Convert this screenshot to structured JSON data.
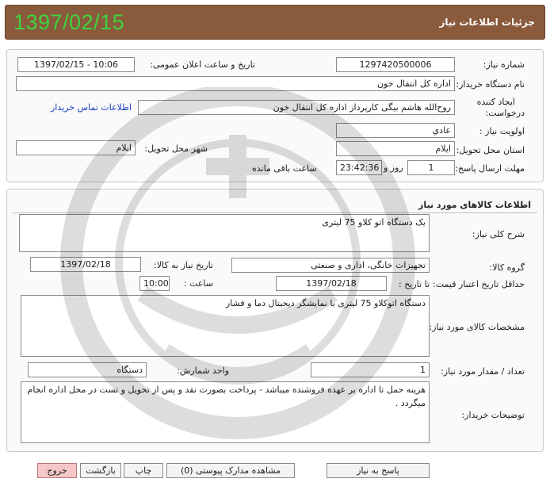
{
  "header": {
    "title": "جزئیات اطلاعات نیاز",
    "date": "1397/02/15"
  },
  "info": {
    "need_number_label": "شماره نیاز:",
    "need_number": "1297420500006",
    "announce_label": "تاریخ و ساعت اعلان عمومی:",
    "announce_value": "1397/02/15 - 10:06",
    "buyer_org_label": "نام دستگاه خریدار:",
    "buyer_org": "اداره کل انتقال خون",
    "creator_label_1": "ایجاد کننده",
    "creator_label_2": "درخواست:",
    "creator": "روح‌الله هاشم بیگی کارپرداز اداره کل انتقال خون",
    "contact_link": "اطلاعات تماس خریدار",
    "priority_label": "اولویت نیاز :",
    "priority": "عادي",
    "province_label": "استان محل تحویل:",
    "province": "ایلام",
    "city_label": "شهر محل تحویل:",
    "city": "ایلام",
    "deadline_label": "مهلت ارسال پاسخ:",
    "deadline_days": "1",
    "days_unit": "روز و",
    "deadline_time": "23:42:36",
    "remaining_label": "ساعت باقی مانده"
  },
  "goods": {
    "section_title": "اطلاعات کالاهای مورد نیاز",
    "summary_label": "شرح کلی نیاز:",
    "summary": "یک دستگاه اتو کلاو 75 لیتری",
    "group_label": "گروه کالا:",
    "group": "تجهیزات خانگی، اداری و صنعتی",
    "need_date_label": "تاریخ نیاز به کالا:",
    "need_date": "1397/02/18",
    "min_validity_label": "حداقل تاریخ اعتبار قیمت:",
    "until_date_label": "تا تاریخ :",
    "until_date": "1397/02/18",
    "time_label": "ساعت :",
    "time": "10:00",
    "specs_label": "مشخصات کالای مورد نیاز:",
    "specs": "دستگاه اتوکلاو 75 لیتری با نمایشگر دیجیتال دما و فشار",
    "qty_label": "تعداد / مقدار مورد نیاز:",
    "qty": "1",
    "unit_label": "واحد شمارش:",
    "unit": "دستگاه",
    "buyer_notes_label": "توضیحات خریدار:",
    "buyer_notes": "هزینه حمل تا اداره بر عهده فروشنده میباشد - پرداخت بصورت نقد و پس از تحویل و تست در محل اداره انجام میگردد ."
  },
  "watermark_text": "هزاره ارتباط",
  "buttons": {
    "reply": "پاسخ به نیاز",
    "attachments": "مشاهده مدارک پیوستی (0)",
    "print": "چاپ",
    "back": "بازگشت",
    "exit": "خروج"
  },
  "colors": {
    "header_bg": "#8a5a3c",
    "date_green": "#3fd33f",
    "link_blue": "#1a3fbf",
    "exit_bg": "#f6c7c7"
  }
}
